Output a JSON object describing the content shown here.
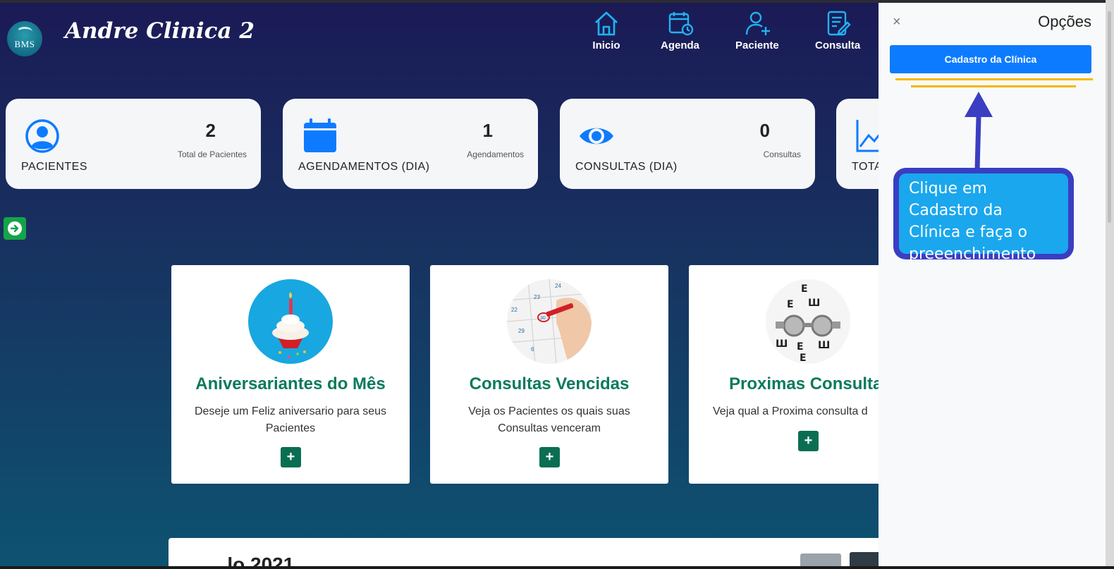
{
  "header": {
    "logo_text": "BMS",
    "app_title": "Andre Clinica 2",
    "nav": [
      {
        "label": "Inicio",
        "icon": "home-icon"
      },
      {
        "label": "Agenda",
        "icon": "calendar-clock-icon"
      },
      {
        "label": "Paciente",
        "icon": "user-plus-icon"
      },
      {
        "label": "Consulta",
        "icon": "clipboard-edit-icon"
      }
    ]
  },
  "stats": [
    {
      "value": "2",
      "subtitle": "Total de Pacientes",
      "title": "PACIENTES",
      "icon": "user-circle-icon"
    },
    {
      "value": "1",
      "subtitle": "Agendamentos",
      "title": "AGENDAMENTOS (DIA)",
      "icon": "calendar-icon"
    },
    {
      "value": "0",
      "subtitle": "Consultas",
      "title": "CONSULTAS (DIA)",
      "icon": "eye-icon"
    },
    {
      "value": "",
      "subtitle": "",
      "title": "TOTA",
      "icon": "line-chart-icon"
    }
  ],
  "features": [
    {
      "title": "Aniversariantes do Mês",
      "description": "Deseje um Feliz aniversario para seus Pacientes",
      "button": "+",
      "image": "birthday-cupcake-image"
    },
    {
      "title": "Consultas Vencidas",
      "description": "Veja os Pacientes os quais suas Consultas venceram",
      "button": "+",
      "image": "calendar-marked-image"
    },
    {
      "title": "Proximas Consulta",
      "description": "Veja qual a Proxima consulta d",
      "button": "+",
      "image": "eye-chart-glasses-image"
    }
  ],
  "bottom_panel": {
    "partial_text": "...lo 2021"
  },
  "offcanvas": {
    "close": "×",
    "title": "Opções",
    "button_label": "Cadastro da Clínica"
  },
  "callout": {
    "text": "Clique em Cadastro da Clínica e faça o preeenchimento"
  },
  "colors": {
    "accent_blue": "#0d7bff",
    "green": "#0a7a5c",
    "highlight": "#f5b800",
    "callout_border": "#3a3ec2",
    "callout_fill": "#1aa7ee"
  }
}
